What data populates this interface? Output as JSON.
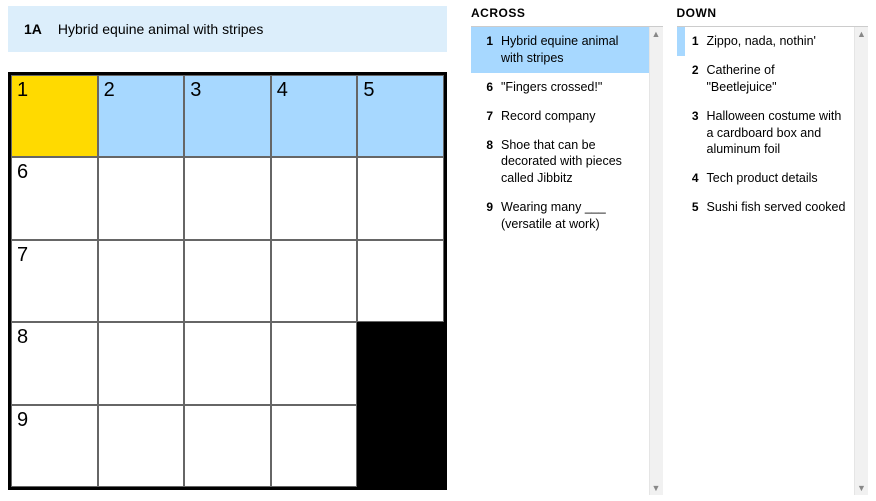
{
  "active_clue": {
    "label": "1A",
    "text": "Hybrid equine animal with stripes"
  },
  "grid": {
    "rows": 5,
    "cols": 5,
    "cells": [
      {
        "r": 0,
        "c": 0,
        "num": "1",
        "state": "selected"
      },
      {
        "r": 0,
        "c": 1,
        "num": "2",
        "state": "hl"
      },
      {
        "r": 0,
        "c": 2,
        "num": "3",
        "state": "hl"
      },
      {
        "r": 0,
        "c": 3,
        "num": "4",
        "state": "hl"
      },
      {
        "r": 0,
        "c": 4,
        "num": "5",
        "state": "hl"
      },
      {
        "r": 1,
        "c": 0,
        "num": "6",
        "state": ""
      },
      {
        "r": 1,
        "c": 1,
        "num": "",
        "state": ""
      },
      {
        "r": 1,
        "c": 2,
        "num": "",
        "state": ""
      },
      {
        "r": 1,
        "c": 3,
        "num": "",
        "state": ""
      },
      {
        "r": 1,
        "c": 4,
        "num": "",
        "state": ""
      },
      {
        "r": 2,
        "c": 0,
        "num": "7",
        "state": ""
      },
      {
        "r": 2,
        "c": 1,
        "num": "",
        "state": ""
      },
      {
        "r": 2,
        "c": 2,
        "num": "",
        "state": ""
      },
      {
        "r": 2,
        "c": 3,
        "num": "",
        "state": ""
      },
      {
        "r": 2,
        "c": 4,
        "num": "",
        "state": ""
      },
      {
        "r": 3,
        "c": 0,
        "num": "8",
        "state": ""
      },
      {
        "r": 3,
        "c": 1,
        "num": "",
        "state": ""
      },
      {
        "r": 3,
        "c": 2,
        "num": "",
        "state": ""
      },
      {
        "r": 3,
        "c": 3,
        "num": "",
        "state": ""
      },
      {
        "r": 3,
        "c": 4,
        "num": "",
        "state": "block"
      },
      {
        "r": 4,
        "c": 0,
        "num": "9",
        "state": ""
      },
      {
        "r": 4,
        "c": 1,
        "num": "",
        "state": ""
      },
      {
        "r": 4,
        "c": 2,
        "num": "",
        "state": ""
      },
      {
        "r": 4,
        "c": 3,
        "num": "",
        "state": ""
      },
      {
        "r": 4,
        "c": 4,
        "num": "",
        "state": "block"
      }
    ]
  },
  "clues": {
    "across": {
      "heading": "ACROSS",
      "items": [
        {
          "num": "1",
          "text": "Hybrid equine animal with stripes",
          "status": "active"
        },
        {
          "num": "6",
          "text": "\"Fingers crossed!\"",
          "status": ""
        },
        {
          "num": "7",
          "text": "Record company",
          "status": ""
        },
        {
          "num": "8",
          "text": "Shoe that can be decorated with pieces called Jibbitz",
          "status": ""
        },
        {
          "num": "9",
          "text": "Wearing many ___ (versatile at work)",
          "status": ""
        }
      ]
    },
    "down": {
      "heading": "DOWN",
      "items": [
        {
          "num": "1",
          "text": "Zippo, nada, nothin'",
          "status": "related"
        },
        {
          "num": "2",
          "text": "Catherine of \"Beetlejuice\"",
          "status": ""
        },
        {
          "num": "3",
          "text": "Halloween costume with a cardboard box and aluminum foil",
          "status": ""
        },
        {
          "num": "4",
          "text": "Tech product details",
          "status": ""
        },
        {
          "num": "5",
          "text": "Sushi fish served cooked",
          "status": ""
        }
      ]
    }
  }
}
